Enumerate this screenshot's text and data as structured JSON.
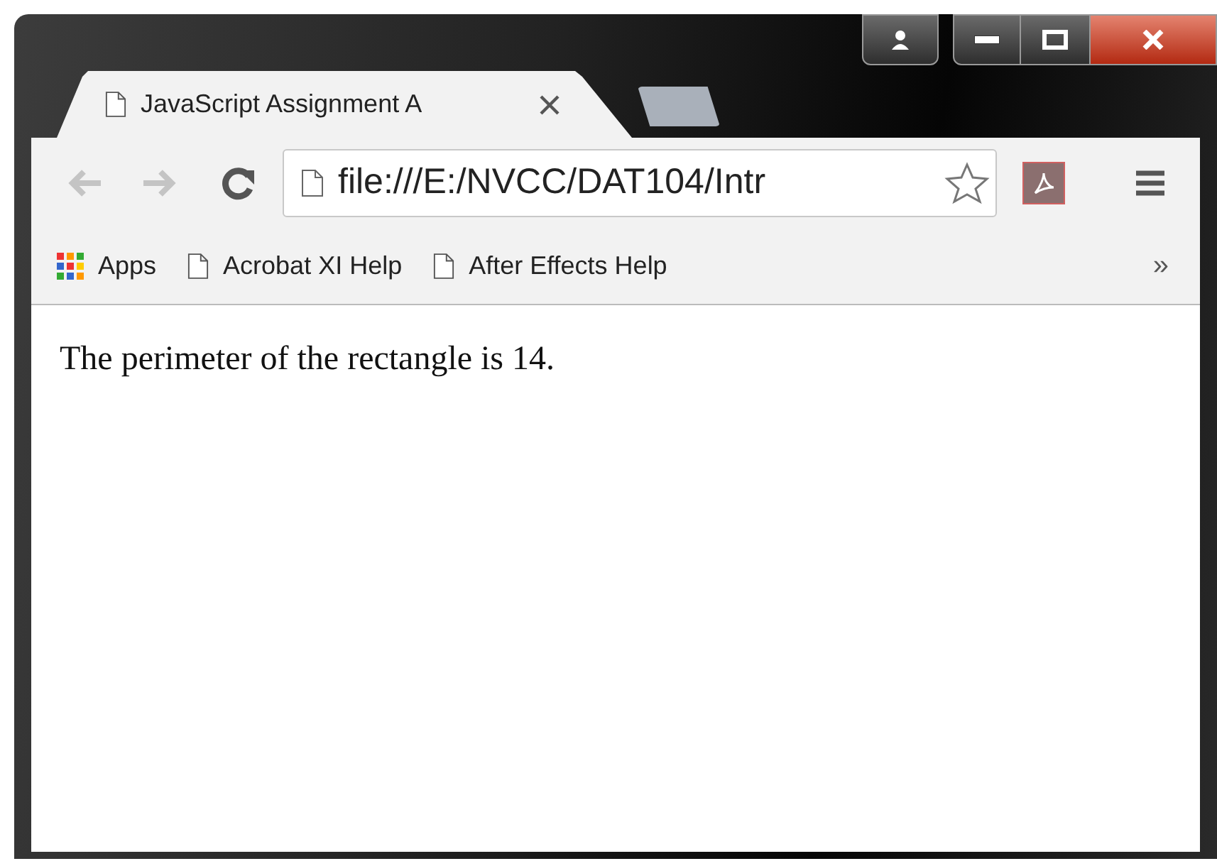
{
  "tabs": [
    {
      "title": "JavaScript Assignment A",
      "selected": true
    }
  ],
  "toolbar": {
    "address": "file:///E:/NVCC/DAT104/Intr"
  },
  "bookmarks": [
    {
      "kind": "apps",
      "label": "Apps"
    },
    {
      "kind": "page",
      "label": "Acrobat XI Help"
    },
    {
      "kind": "page",
      "label": "After Effects Help"
    }
  ],
  "bookmarks_overflow": "»",
  "page": {
    "text": "The perimeter of the rectangle is 14."
  }
}
